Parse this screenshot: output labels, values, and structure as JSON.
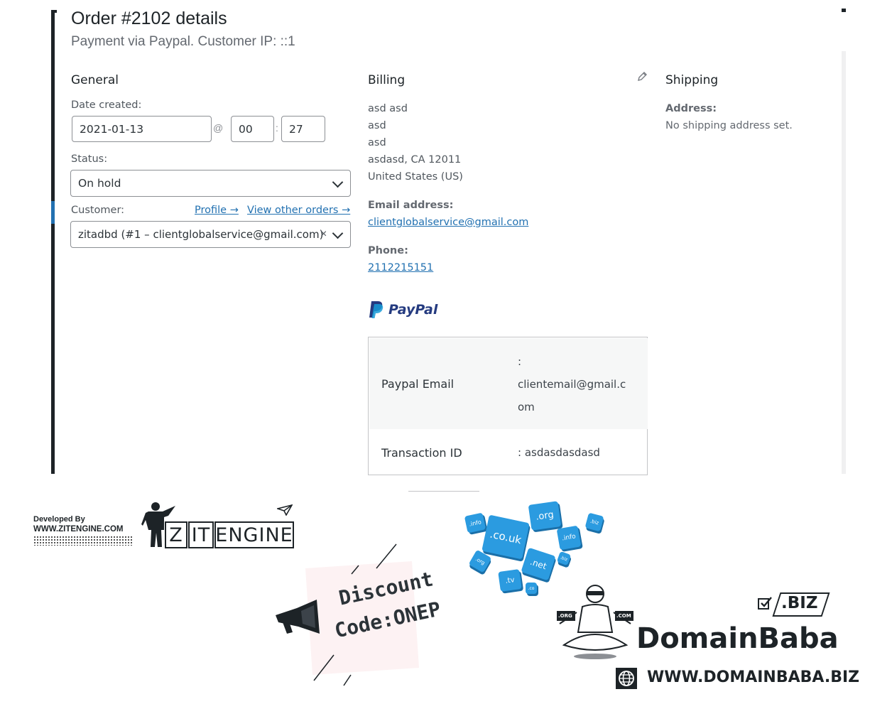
{
  "header": {
    "title": "Order #2102 details",
    "subtitle": "Payment via Paypal. Customer IP: ::1"
  },
  "general": {
    "heading": "General",
    "date_label": "Date created:",
    "date_value": "2021-01-13",
    "at_sep": "@",
    "hour": "00",
    "colon": ":",
    "minute": "27",
    "status_label": "Status:",
    "status_value": "On hold",
    "customer_label": "Customer:",
    "profile_link": "Profile →",
    "other_orders_link": "View other orders →",
    "customer_value": "zitadbd (#1 – clientglobalservice@gmail.com)",
    "clear_symbol": "×"
  },
  "billing": {
    "heading": "Billing",
    "lines": [
      "asd asd",
      "asd",
      "asd",
      "asdasd, CA 12011",
      "United States (US)"
    ],
    "email_label": "Email address:",
    "email_value": "clientglobalservice@gmail.com",
    "phone_label": "Phone:",
    "phone_value": "2112215151",
    "paypal_logo_text": "PayPal",
    "paypal_table": {
      "row1_key": "Paypal Email",
      "row1_val_lines": [
        ":",
        "clientemail@gmail.c",
        "om"
      ],
      "row2_key": "Transaction ID",
      "row2_val": ": asdasdasdasd"
    }
  },
  "shipping": {
    "heading": "Shipping",
    "address_label": "Address:",
    "address_value": "No shipping address set."
  },
  "promo": {
    "developed_by": "Developed By",
    "website": "WWW.ZITENGINE.COM",
    "zit_letters": [
      "Z",
      "IT",
      "ENGINE"
    ],
    "discount_line1": "Discount",
    "discount_line2": "Code:ONEP",
    "tlds": [
      ".org",
      ".co.uk",
      ".info",
      ".biz",
      ".net",
      ".tv",
      ".info",
      ".org",
      ".co",
      ".biz"
    ],
    "biz_badge": ".BIZ",
    "org_tag": ".ORG",
    "com_tag": ".COM",
    "domainbaba": "DomainBaba",
    "domainbaba_url": "WWW.DOMAINBABA.BIZ"
  },
  "colors": {
    "link": "#2271b1",
    "paypal_dark": "#253b80",
    "paypal_light": "#179bd7",
    "tile_blue": "#2b9be0"
  }
}
